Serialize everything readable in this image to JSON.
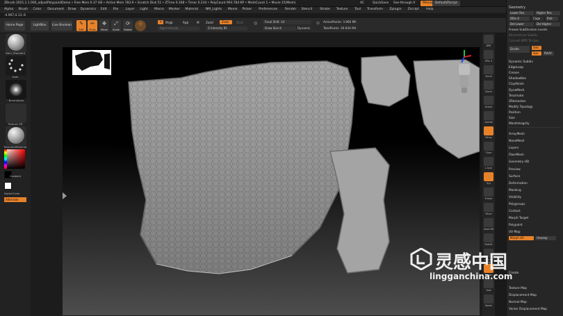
{
  "titlebar": {
    "app": "ZBrush 2021.1.1",
    "document": "000_adjustPolypaintDemo",
    "free_mem": "Free Mem 9.37 GB",
    "active_mem": "Active Mem 783.9",
    "scratch_disk": "Scratch Disk 51",
    "ztime": "ZTime 0.168",
    "timer": "Timer 0.234",
    "polycount": "PolyCount 993.784 KP",
    "meshcount": "MeshCount 1",
    "movie": "Movie 15(Mesh)",
    "ac": "AC",
    "quicksave": "QuickSave",
    "seethrough": "See-through  0",
    "menus": "Menus",
    "default_zscript": "DefaultZScript"
  },
  "menus": [
    "Alpha",
    "Brush",
    "Color",
    "Document",
    "Draw",
    "Dynamics",
    "Edit",
    "File",
    "Layer",
    "Light",
    "Macro",
    "Marker",
    "Material",
    "NM_Lights",
    "Movie",
    "Picker",
    "Preferences",
    "Render",
    "Stencil",
    "Stroke",
    "Texture",
    "Tool",
    "Transform",
    "Zplugin",
    "Zscript",
    "Help"
  ],
  "coords": "-4.967,4.13,-6",
  "toolbar": {
    "home_page": "Home Page",
    "lightbox": "LightBox",
    "live_boolean": "Live Boolean",
    "edit": "Edit",
    "draw": "Draw",
    "move": "Move",
    "scale": "Scale",
    "rotate": "Rotate",
    "a_label": "A",
    "mrgb": "Mrgb",
    "rgb": "Rgb",
    "m": "M",
    "zadd": "Zadd",
    "zsub": "Zsub",
    "zcut": "Zcut",
    "rgb_intensity": "Rgb Intensity",
    "z_intensity": "Z Intensity 85",
    "focal_shift": "Focal Shift -14",
    "draw_size": "Draw Size 8",
    "dynamic": "Dynamic",
    "active_points": "ActivePoints: 3.966 Mil",
    "total_points": "TotalPoints: 26.644 Mil"
  },
  "leftshelf": {
    "brush": "Dam_Standard",
    "stroke": "Dots",
    "alpha": "~BrushAlpha",
    "texture": "Texture Off",
    "material": "StandardMaterial",
    "gradient": "Gradient",
    "switch_color": "SwitchColor",
    "alternate": "Alternate"
  },
  "rightshelf": [
    "BPR",
    "SPix 3",
    "Scroll",
    "Zoom",
    "Actual",
    "AAHalf",
    "Persp",
    "Floor",
    "L.Sym",
    "Xyz",
    "Frame",
    "Move",
    "Zoom3D",
    "RotaTe",
    "Line Fill PolyF",
    "Transp",
    "Solo",
    "Xpose"
  ],
  "tray": {
    "geometry": "Geometry",
    "lower_res": "Lower Res",
    "higher_res": "Higher Res",
    "sdiv": "SDiv 6",
    "cage": "Cage",
    "rstr": "Rstr",
    "del_lower": "Del Lower",
    "del_higher": "Del Higher",
    "freeze_subdiv": "Freeze SubDivision Levels",
    "reconstruct_subdiv": "Reconstruct Subdiv",
    "convert_bpr": "Convert BPR To Geo",
    "divide": "Divide",
    "smt": "Smt",
    "suv": "Suv",
    "rsmt": "ReUV",
    "items": [
      "Dynamic Subdiv",
      "EdgeLoop",
      "Crease",
      "ShadowBox",
      "ClayPolish",
      "DynaMesh",
      "Tessimate",
      "ZRemesher",
      "Modify Topology",
      "Position",
      "Size",
      "MeshIntegrity"
    ],
    "subpalettes": [
      "ArrayMesh",
      "NanoMesh",
      "Layers",
      "FiberMesh",
      "Geometry HD",
      "Preview",
      "Surface",
      "Deformation",
      "Masking",
      "Visibility",
      "Polygroups",
      "Contact",
      "Morph Target",
      "Polypaint",
      "UV Map"
    ],
    "morph_uv": "Morph UV",
    "unwrap": "Unwrap",
    "texture_map": "Texture Map",
    "displacement_map": "Displacement Map",
    "normal_map": "Normal Map",
    "vector_displacement_map": "Vector Displacement Map",
    "create": "Create"
  },
  "watermark": {
    "cn": "灵感中国",
    "url": "lingganchina.com",
    "logo": "lingganchina-logo"
  },
  "colors": {
    "accent": "#e8822a",
    "panel": "#262626",
    "mesh": "#a3a3a3"
  }
}
